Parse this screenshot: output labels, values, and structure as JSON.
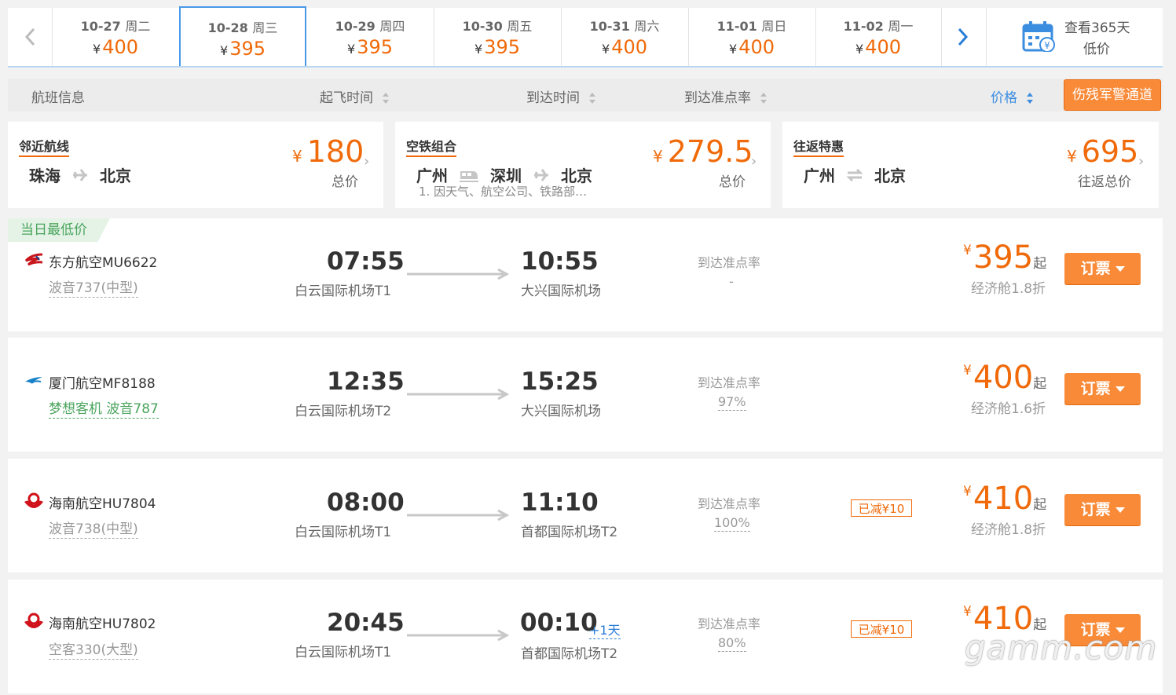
{
  "datebar": {
    "prev_icon": "chevron-left-icon",
    "next_icon": "chevron-right-icon",
    "dates": [
      {
        "date": "10-27",
        "weekday": "周二",
        "price": "400"
      },
      {
        "date": "10-28",
        "weekday": "周三",
        "price": "395",
        "selected": true
      },
      {
        "date": "10-29",
        "weekday": "周四",
        "price": "395"
      },
      {
        "date": "10-30",
        "weekday": "周五",
        "price": "395"
      },
      {
        "date": "10-31",
        "weekday": "周六",
        "price": "400"
      },
      {
        "date": "11-01",
        "weekday": "周日",
        "price": "400"
      },
      {
        "date": "11-02",
        "weekday": "周一",
        "price": "400"
      }
    ],
    "yen": "¥",
    "calendar": {
      "line1": "查看365天",
      "line2": "低价",
      "icon": "calendar-price-icon"
    }
  },
  "sortbar": {
    "flight_info": "航班信息",
    "depart_time": "起飞时间",
    "arrive_time": "到达时间",
    "ontime_rate": "到达准点率",
    "price": "价格",
    "military_button": "伤残军警通道",
    "active_color": "#3b8de0"
  },
  "promos": [
    {
      "title": "邻近航线",
      "from": "珠海",
      "to": "北京",
      "yen": "¥",
      "price": "180",
      "label": "总价"
    },
    {
      "title": "空铁组合",
      "from": "广州",
      "via": "深圳",
      "to": "北京",
      "note": "1. 因天气、航空公司、铁路部…",
      "yen": "¥",
      "price": "279.5",
      "label": "总价"
    },
    {
      "title": "往返特惠",
      "from": "广州",
      "to": "北京",
      "yen": "¥",
      "price": "695",
      "label": "往返总价"
    }
  ],
  "lowest_tag": "当日最低价",
  "flights": [
    {
      "airline": "东方航空MU6622",
      "logo": "china-eastern-logo",
      "aircraft": "波音737(中型)",
      "dep_time": "07:55",
      "dep_airport": "白云国际机场T1",
      "arr_time": "10:55",
      "arr_airport": "大兴国际机场",
      "ontime_label": "到达准点率",
      "ontime": "-",
      "discount": "",
      "price": "395",
      "qi": "起",
      "cabin": "经济舱1.8折",
      "book": "订票"
    },
    {
      "airline": "厦门航空MF8188",
      "logo": "xiamen-airlines-logo",
      "aircraft": "梦想客机 波音787",
      "dep_time": "12:35",
      "dep_airport": "白云国际机场T2",
      "arr_time": "15:25",
      "arr_airport": "大兴国际机场",
      "ontime_label": "到达准点率",
      "ontime": "97%",
      "discount": "",
      "price": "400",
      "qi": "起",
      "cabin": "经济舱1.6折",
      "book": "订票"
    },
    {
      "airline": "海南航空HU7804",
      "logo": "hainan-airlines-logo",
      "aircraft": "波音738(中型)",
      "dep_time": "08:00",
      "dep_airport": "白云国际机场T1",
      "arr_time": "11:10",
      "arr_airport": "首都国际机场T2",
      "ontime_label": "到达准点率",
      "ontime": "100%",
      "discount": "已减¥10",
      "price": "410",
      "qi": "起",
      "cabin": "经济舱1.8折",
      "book": "订票"
    },
    {
      "airline": "海南航空HU7802",
      "logo": "hainan-airlines-logo",
      "aircraft": "空客330(大型)",
      "dep_time": "20:45",
      "dep_airport": "白云国际机场T1",
      "arr_time": "00:10",
      "arr_plus": "+1天",
      "arr_airport": "首都国际机场T2",
      "ontime_label": "到达准点率",
      "ontime": "80%",
      "discount": "已减¥10",
      "price": "410",
      "qi": "起",
      "cabin": "",
      "book": "订票"
    }
  ],
  "yen": "¥",
  "watermark": "gamm.com"
}
